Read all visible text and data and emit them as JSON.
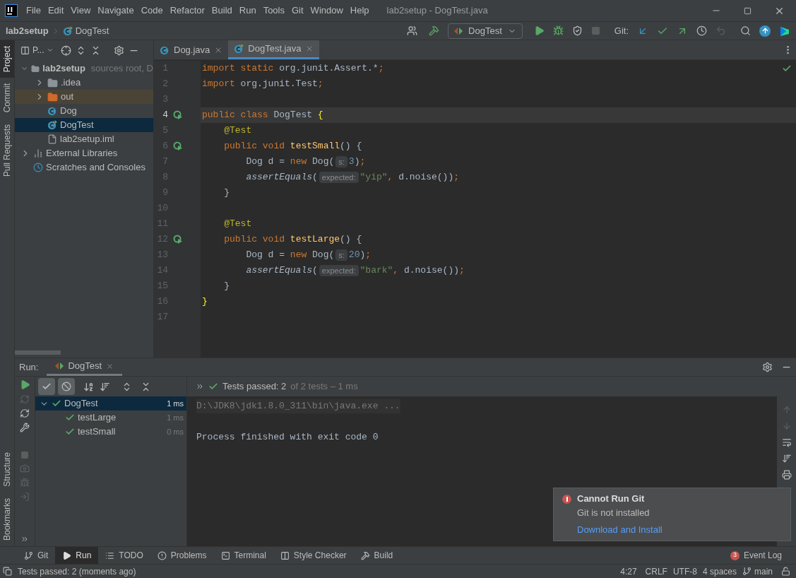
{
  "window": {
    "title": "lab2setup - DogTest.java"
  },
  "menu": [
    "File",
    "Edit",
    "View",
    "Navigate",
    "Code",
    "Refactor",
    "Build",
    "Run",
    "Tools",
    "Git",
    "Window",
    "Help"
  ],
  "breadcrumb": [
    "lab2setup",
    "DogTest"
  ],
  "toolbar": {
    "run_config": "DogTest",
    "git_label": "Git:"
  },
  "left_tabs": [
    {
      "label": "Project",
      "selected": true
    },
    {
      "label": "Commit",
      "selected": false
    },
    {
      "label": "Pull Requests",
      "selected": false
    }
  ],
  "left_tabs_bottom": [
    {
      "label": "Structure",
      "selected": false
    },
    {
      "label": "Bookmarks",
      "selected": false
    }
  ],
  "project": {
    "view_selector": "P...",
    "tree": [
      {
        "label": "lab2setup",
        "kind": "module",
        "hint": "sources root, D",
        "expanded": true,
        "selected": false,
        "children": [
          {
            "label": ".idea",
            "kind": "folder",
            "expanded": false,
            "selected": false
          },
          {
            "label": "out",
            "kind": "excluded",
            "expanded": false,
            "selected": false
          },
          {
            "label": "Dog",
            "kind": "class",
            "selected": false
          },
          {
            "label": "DogTest",
            "kind": "test",
            "selected": true
          },
          {
            "label": "lab2setup.iml",
            "kind": "file",
            "selected": false
          }
        ]
      },
      {
        "label": "External Libraries",
        "kind": "library",
        "expanded": false,
        "selected": false
      },
      {
        "label": "Scratches and Consoles",
        "kind": "scratches",
        "selected": false
      }
    ]
  },
  "editor_tabs": [
    {
      "label": "Dog.java",
      "kind": "class",
      "selected": false
    },
    {
      "label": "DogTest.java",
      "kind": "test",
      "selected": true
    }
  ],
  "editor": {
    "lines": [
      {
        "number": "1",
        "current": false,
        "run_marker": false,
        "tokens": [
          {
            "text": "import static ",
            "kind": "keyword"
          },
          {
            "text": "org.junit.Assert.*",
            "kind": "plain"
          },
          {
            "text": ";",
            "kind": "keyword"
          }
        ]
      },
      {
        "number": "2",
        "current": false,
        "run_marker": false,
        "tokens": [
          {
            "text": "import ",
            "kind": "keyword"
          },
          {
            "text": "org.junit.Test",
            "kind": "plain"
          },
          {
            "text": ";",
            "kind": "keyword"
          }
        ]
      },
      {
        "number": "3",
        "current": false,
        "run_marker": false
      },
      {
        "number": "4",
        "current": true,
        "run_marker": true,
        "tokens": [
          {
            "text": "public class ",
            "kind": "keyword"
          },
          {
            "text": "DogTest ",
            "kind": "plain"
          },
          {
            "text": "{",
            "kind": "brace"
          }
        ]
      },
      {
        "number": "5",
        "current": false,
        "run_marker": false,
        "tokens": [
          {
            "text": "    @Test",
            "kind": "annotation"
          }
        ]
      },
      {
        "number": "6",
        "current": false,
        "run_marker": true,
        "tokens": [
          {
            "text": "    public void ",
            "kind": "keyword"
          },
          {
            "text": "testSmall",
            "kind": "method"
          },
          {
            "text": "() {",
            "kind": "plain"
          }
        ]
      },
      {
        "number": "7",
        "current": false,
        "run_marker": false,
        "tokens": [
          {
            "text": "        Dog d = ",
            "kind": "plain"
          },
          {
            "text": "new ",
            "kind": "keyword"
          },
          {
            "text": "Dog(",
            "kind": "plain"
          },
          {
            "text": "s:",
            "kind": "hint"
          },
          {
            "text": "3",
            "kind": "number"
          },
          {
            "text": ")",
            "kind": "plain"
          },
          {
            "text": ";",
            "kind": "keyword"
          }
        ]
      },
      {
        "number": "8",
        "current": false,
        "run_marker": false,
        "tokens": [
          {
            "text": "        assertEquals",
            "kind": "call"
          },
          {
            "text": "(",
            "kind": "plain"
          },
          {
            "text": "expected:",
            "kind": "hint"
          },
          {
            "text": "\"yip\"",
            "kind": "string"
          },
          {
            "text": ", ",
            "kind": "keyword"
          },
          {
            "text": "d.noise())",
            "kind": "plain"
          },
          {
            "text": ";",
            "kind": "keyword"
          }
        ]
      },
      {
        "number": "9",
        "current": false,
        "run_marker": false,
        "tokens": [
          {
            "text": "    }",
            "kind": "plain"
          }
        ]
      },
      {
        "number": "10",
        "current": false,
        "run_marker": false
      },
      {
        "number": "11",
        "current": false,
        "run_marker": false,
        "tokens": [
          {
            "text": "    @Test",
            "kind": "annotation"
          }
        ]
      },
      {
        "number": "12",
        "current": false,
        "run_marker": true,
        "tokens": [
          {
            "text": "    public void ",
            "kind": "keyword"
          },
          {
            "text": "testLarge",
            "kind": "method"
          },
          {
            "text": "() {",
            "kind": "plain"
          }
        ]
      },
      {
        "number": "13",
        "current": false,
        "run_marker": false,
        "tokens": [
          {
            "text": "        Dog d = ",
            "kind": "plain"
          },
          {
            "text": "new ",
            "kind": "keyword"
          },
          {
            "text": "Dog(",
            "kind": "plain"
          },
          {
            "text": "s:",
            "kind": "hint"
          },
          {
            "text": "20",
            "kind": "number"
          },
          {
            "text": ")",
            "kind": "plain"
          },
          {
            "text": ";",
            "kind": "keyword"
          }
        ]
      },
      {
        "number": "14",
        "current": false,
        "run_marker": false,
        "tokens": [
          {
            "text": "        assertEquals",
            "kind": "call"
          },
          {
            "text": "(",
            "kind": "plain"
          },
          {
            "text": "expected:",
            "kind": "hint"
          },
          {
            "text": "\"bark\"",
            "kind": "string"
          },
          {
            "text": ", ",
            "kind": "keyword"
          },
          {
            "text": "d.noise())",
            "kind": "plain"
          },
          {
            "text": ";",
            "kind": "keyword"
          }
        ]
      },
      {
        "number": "15",
        "current": false,
        "run_marker": false,
        "tokens": [
          {
            "text": "    }",
            "kind": "plain"
          }
        ]
      },
      {
        "number": "16",
        "current": false,
        "run_marker": false,
        "tokens": [
          {
            "text": "}",
            "kind": "brace"
          }
        ]
      },
      {
        "number": "17",
        "current": false,
        "run_marker": false
      }
    ]
  },
  "run": {
    "label": "Run:",
    "tab": "DogTest",
    "summary": "Tests passed: 2",
    "summary_detail": "of 2 tests – 1 ms",
    "tests": [
      {
        "name": "DogTest",
        "time": "1 ms",
        "passed": true,
        "selected": true,
        "expanded": true,
        "children": [
          {
            "name": "testLarge",
            "time": "1 ms",
            "passed": true,
            "selected": false
          },
          {
            "name": "testSmall",
            "time": "0 ms",
            "passed": true,
            "selected": false
          }
        ]
      }
    ],
    "console": [
      {
        "text": "D:\\JDK8\\jdk1.8.0_311\\bin\\java.exe ...",
        "kind": "command"
      },
      {
        "text": "Process finished with exit code 0",
        "kind": "output"
      }
    ]
  },
  "notification": {
    "title": "Cannot Run Git",
    "message": "Git is not installed",
    "link": "Download and Install"
  },
  "tool_windows": [
    {
      "label": "Git",
      "kind": "git",
      "selected": false
    },
    {
      "label": "Run",
      "kind": "run",
      "selected": true
    },
    {
      "label": "TODO",
      "kind": "todo",
      "selected": false
    },
    {
      "label": "Problems",
      "kind": "problems",
      "selected": false
    },
    {
      "label": "Terminal",
      "kind": "terminal",
      "selected": false
    },
    {
      "label": "Style Checker",
      "kind": "style",
      "selected": false
    },
    {
      "label": "Build",
      "kind": "build",
      "selected": false
    }
  ],
  "event_log": {
    "label": "Event Log",
    "count": "3"
  },
  "status_bar": {
    "message": "Tests passed: 2 (moments ago)",
    "position": "4:27",
    "line_separator": "CRLF",
    "encoding": "UTF-8",
    "indent": "4 spaces",
    "branch": "main"
  }
}
